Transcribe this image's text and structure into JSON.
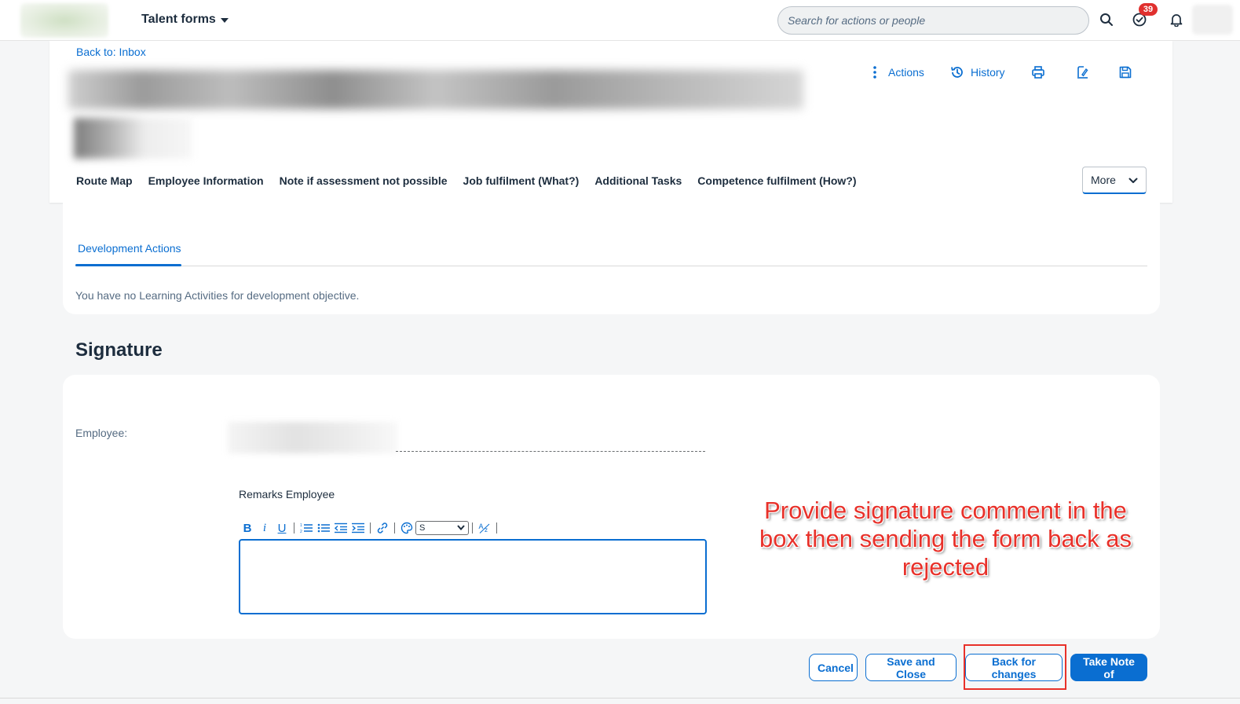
{
  "shell": {
    "app_title": "Talent forms",
    "search_placeholder": "Search for actions or people",
    "notification_count": "39"
  },
  "header": {
    "back_link": "Back to: Inbox",
    "toolbar": {
      "actions_label": "Actions",
      "history_label": "History"
    },
    "tabs": [
      {
        "label": "Route Map"
      },
      {
        "label": "Employee Information"
      },
      {
        "label": "Note if assessment not possible"
      },
      {
        "label": "Job fulfilment (What?)"
      },
      {
        "label": "Additional Tasks"
      },
      {
        "label": "Competence fulfilment (How?)"
      }
    ],
    "more_label": "More"
  },
  "development": {
    "tab_label": "Development Actions",
    "empty_message": "You have no Learning Activities for development objective."
  },
  "signature": {
    "heading": "Signature",
    "employee_label": "Employee:",
    "remarks_label": "Remarks Employee",
    "font_size_value": "S"
  },
  "annotation": {
    "text": "Provide signature comment in the box then sending the form back as rejected",
    "color": "#e8312a"
  },
  "footer": {
    "cancel_label": "Cancel",
    "save_close_label": "Save and Close",
    "back_for_changes_label": "Back for changes",
    "take_note_label": "Take Note of"
  },
  "colors": {
    "accent": "#0a6ed1",
    "badge": "#e0302e"
  }
}
